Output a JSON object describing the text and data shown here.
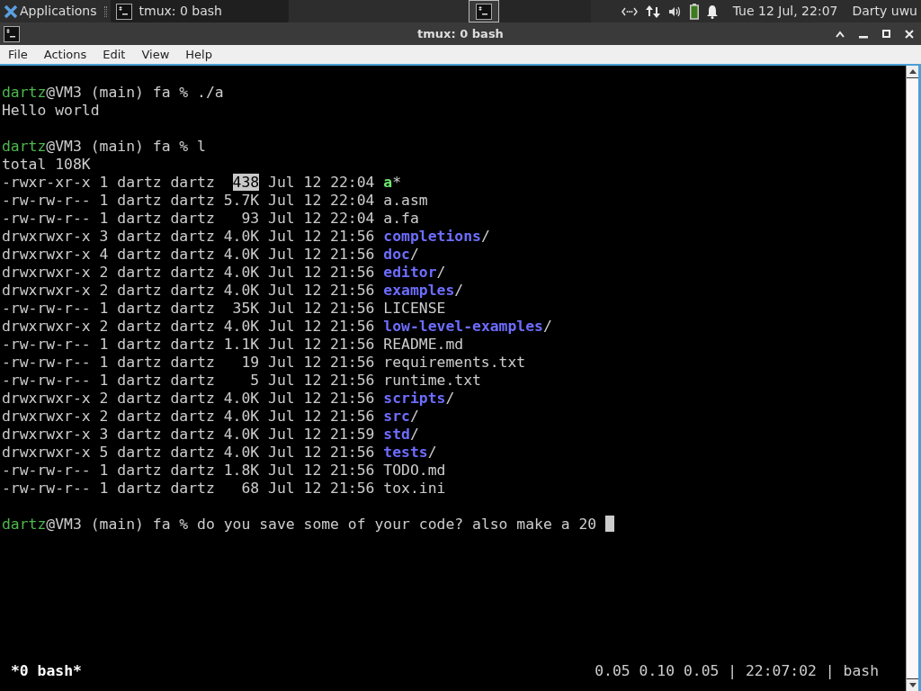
{
  "panel": {
    "apps_label": "Applications",
    "tasks": [
      {
        "title": "tmux: 0 bash",
        "selected": true
      }
    ],
    "workspaces": [
      {
        "selected": true
      },
      {
        "selected": false
      },
      {
        "selected": false
      },
      {
        "selected": false
      }
    ],
    "clock": "Tue 12 Jul, 22:07",
    "user": "Darty uwu"
  },
  "window": {
    "title": "tmux: 0 bash"
  },
  "menu": [
    "File",
    "Actions",
    "Edit",
    "View",
    "Help"
  ],
  "terminal": {
    "lines": [
      {
        "blank_before": true,
        "segments": [
          {
            "text": "dartz",
            "kind": "user"
          },
          {
            "text": "@VM3 (main) fa % ./a",
            "kind": "plain"
          }
        ]
      },
      [
        {
          "text": "Hello world",
          "kind": "plain"
        }
      ],
      {
        "blank_before": true,
        "segments": [
          {
            "text": "dartz",
            "kind": "user"
          },
          {
            "text": "@VM3 (main) fa % l",
            "kind": "plain"
          }
        ]
      },
      [
        {
          "text": "total 108K",
          "kind": "plain"
        }
      ],
      [
        {
          "text": "-rwxr-xr-x 1 dartz dartz  ",
          "kind": "plain"
        },
        {
          "text": "438",
          "kind": "selected"
        },
        {
          "text": " Jul 12 22:04 ",
          "kind": "plain"
        },
        {
          "text": "a",
          "kind": "exec"
        },
        {
          "text": "*",
          "kind": "plain"
        }
      ],
      [
        {
          "text": "-rw-rw-r-- 1 dartz dartz 5.7K Jul 12 22:04 a.asm",
          "kind": "plain"
        }
      ],
      [
        {
          "text": "-rw-rw-r-- 1 dartz dartz   93 Jul 12 22:04 a.fa",
          "kind": "plain"
        }
      ],
      [
        {
          "text": "drwxrwxr-x 3 dartz dartz 4.0K Jul 12 21:56 ",
          "kind": "plain"
        },
        {
          "text": "completions",
          "kind": "dir"
        },
        {
          "text": "/",
          "kind": "plain"
        }
      ],
      [
        {
          "text": "drwxrwxr-x 4 dartz dartz 4.0K Jul 12 21:56 ",
          "kind": "plain"
        },
        {
          "text": "doc",
          "kind": "dir"
        },
        {
          "text": "/",
          "kind": "plain"
        }
      ],
      [
        {
          "text": "drwxrwxr-x 2 dartz dartz 4.0K Jul 12 21:56 ",
          "kind": "plain"
        },
        {
          "text": "editor",
          "kind": "dir"
        },
        {
          "text": "/",
          "kind": "plain"
        }
      ],
      [
        {
          "text": "drwxrwxr-x 2 dartz dartz 4.0K Jul 12 21:56 ",
          "kind": "plain"
        },
        {
          "text": "examples",
          "kind": "dir"
        },
        {
          "text": "/",
          "kind": "plain"
        }
      ],
      [
        {
          "text": "-rw-rw-r-- 1 dartz dartz  35K Jul 12 21:56 LICENSE",
          "kind": "plain"
        }
      ],
      [
        {
          "text": "drwxrwxr-x 2 dartz dartz 4.0K Jul 12 21:56 ",
          "kind": "plain"
        },
        {
          "text": "low-level-examples",
          "kind": "dir"
        },
        {
          "text": "/",
          "kind": "plain"
        }
      ],
      [
        {
          "text": "-rw-rw-r-- 1 dartz dartz 1.1K Jul 12 21:56 README.md",
          "kind": "plain"
        }
      ],
      [
        {
          "text": "-rw-rw-r-- 1 dartz dartz   19 Jul 12 21:56 requirements.txt",
          "kind": "plain"
        }
      ],
      [
        {
          "text": "-rw-rw-r-- 1 dartz dartz    5 Jul 12 21:56 runtime.txt",
          "kind": "plain"
        }
      ],
      [
        {
          "text": "drwxrwxr-x 2 dartz dartz 4.0K Jul 12 21:56 ",
          "kind": "plain"
        },
        {
          "text": "scripts",
          "kind": "dir"
        },
        {
          "text": "/",
          "kind": "plain"
        }
      ],
      [
        {
          "text": "drwxrwxr-x 2 dartz dartz 4.0K Jul 12 21:56 ",
          "kind": "plain"
        },
        {
          "text": "src",
          "kind": "dir"
        },
        {
          "text": "/",
          "kind": "plain"
        }
      ],
      [
        {
          "text": "drwxrwxr-x 3 dartz dartz 4.0K Jul 12 21:59 ",
          "kind": "plain"
        },
        {
          "text": "std",
          "kind": "dir"
        },
        {
          "text": "/",
          "kind": "plain"
        }
      ],
      [
        {
          "text": "drwxrwxr-x 5 dartz dartz 4.0K Jul 12 21:56 ",
          "kind": "plain"
        },
        {
          "text": "tests",
          "kind": "dir"
        },
        {
          "text": "/",
          "kind": "plain"
        }
      ],
      [
        {
          "text": "-rw-rw-r-- 1 dartz dartz 1.8K Jul 12 21:56 TODO.md",
          "kind": "plain"
        }
      ],
      [
        {
          "text": "-rw-rw-r-- 1 dartz dartz   68 Jul 12 21:56 tox.ini",
          "kind": "plain"
        }
      ],
      {
        "blank_before": true,
        "segments": [
          {
            "text": "dartz",
            "kind": "user"
          },
          {
            "text": "@VM3 (main) fa % do you save some of your code? also make a 20 ",
            "kind": "plain"
          },
          {
            "kind": "cursor"
          }
        ]
      }
    ],
    "status_left": "*0 bash*",
    "status_right": "0.05 0.10 0.05 | 22:07:02 | bash"
  }
}
